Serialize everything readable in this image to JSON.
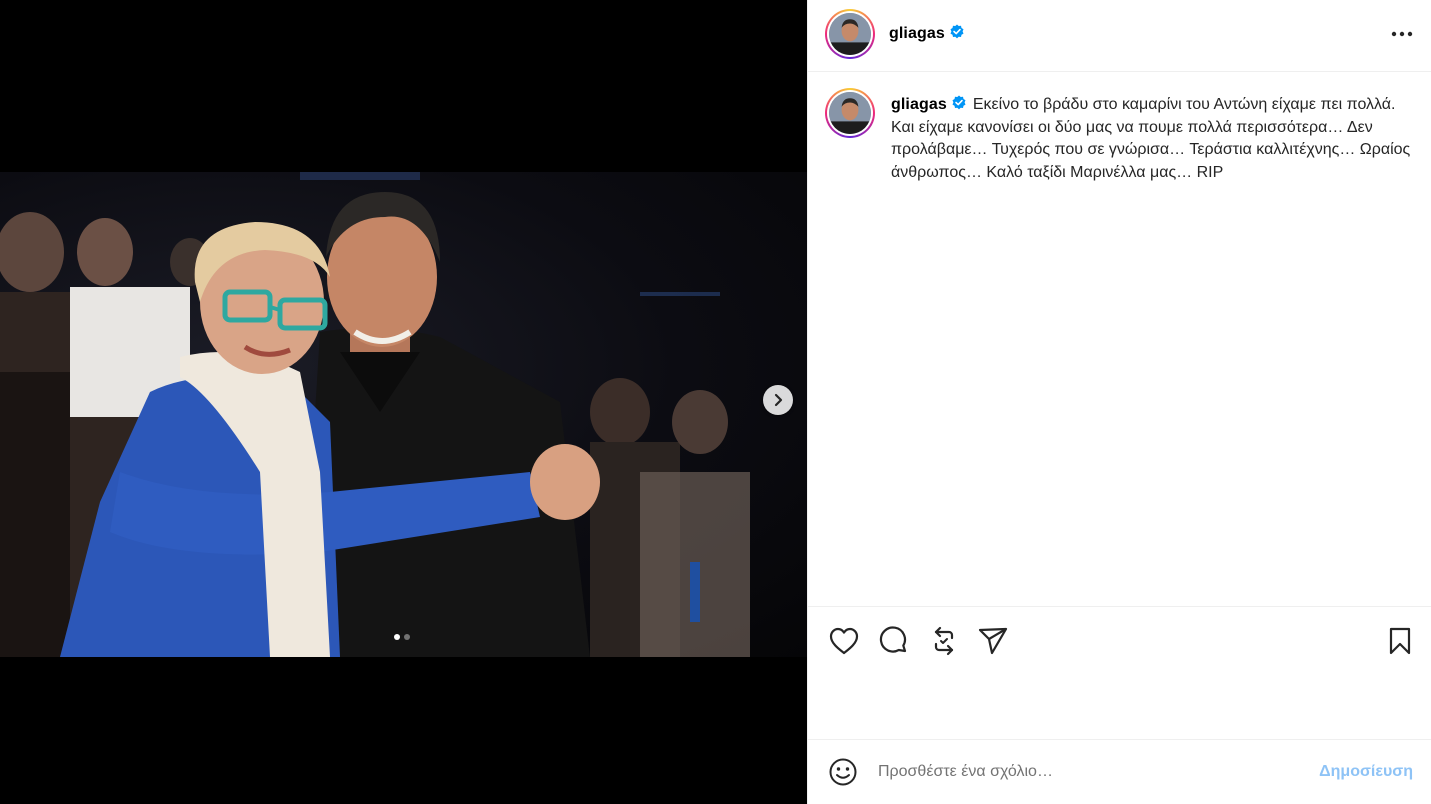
{
  "post": {
    "username": "gliagas",
    "verified": true,
    "caption": "Εκείνο το βράδυ στο καμαρίνι του Αντώνη είχαμε πει πολλά. Και είχαμε κανονίσει οι δύο μας να πουμε πολλά περισσότερα… Δεν προλάβαμε… Τυχερός που σε γνώρισα… Τεράστια καλλιτέχνης… Ωραίος άνθρωπος… Καλό ταξίδι Μαρινέλλα μας… RIP",
    "media": {
      "slide_count": 2,
      "current_slide": 1
    }
  },
  "actions": {
    "icons": [
      "heart-icon",
      "comment-icon",
      "repost-icon",
      "share-icon",
      "bookmark-icon"
    ]
  },
  "comment_box": {
    "placeholder": "Προσθέστε ένα σχόλιο…",
    "post_label": "Δημοσίευση"
  },
  "colors": {
    "verified_blue": "#0095f6",
    "post_button": "#8ec3f6",
    "divider": "#efefef"
  }
}
